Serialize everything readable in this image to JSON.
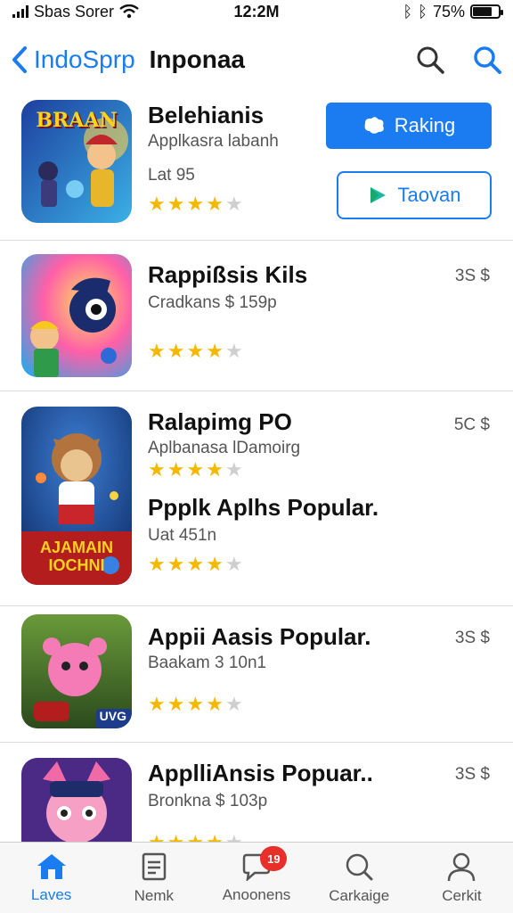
{
  "status": {
    "carrier": "Sbas Sorer",
    "time": "12:2M",
    "battery": "75%",
    "battery_level": 0.75
  },
  "nav": {
    "back_label": "IndoSprp",
    "title": "Inponaa"
  },
  "featured": {
    "title": "Belehianis",
    "subtitle": "Applkasra labanh",
    "meta": "Lat  95",
    "rating": 4,
    "primary_button": "Raking",
    "secondary_button": "Taovan"
  },
  "apps": [
    {
      "title": "Rappißsis Kils",
      "subtitle": "Cradkans $ 159p",
      "price": "3S $",
      "rating": 3.5
    },
    {
      "title": "Ralapimg PO",
      "subtitle": "Aplbanasa lDamoirg",
      "price": "5C $",
      "rating": 3.5,
      "title2": "Ppplk Aplhs Popular.",
      "meta": "Uat  451n",
      "rating2": 3.5
    },
    {
      "title": "Appii Aasis Popular.",
      "subtitle": "Baakam 3 10n1",
      "price": "3S $",
      "rating": 3.5
    },
    {
      "title": "ApplliAnsis Popuar..",
      "subtitle": "Bronkna $ 103p",
      "price": "3S $",
      "rating": 3.5
    }
  ],
  "icons": {
    "featured": "BRAAN",
    "app2_banner": "AJAMAIN IOCHNI",
    "app3_badge": "UVG"
  },
  "tabs": [
    {
      "label": "Laves",
      "icon": "home-icon",
      "active": true
    },
    {
      "label": "Nemk",
      "icon": "document-icon"
    },
    {
      "label": "Anoonens",
      "icon": "chat-icon",
      "badge": "19"
    },
    {
      "label": "Carkaige",
      "icon": "search-icon"
    },
    {
      "label": "Cerkit",
      "icon": "person-icon"
    }
  ],
  "colors": {
    "accent": "#1a7cf0",
    "star": "#f5b800",
    "badge": "#e8302a"
  }
}
